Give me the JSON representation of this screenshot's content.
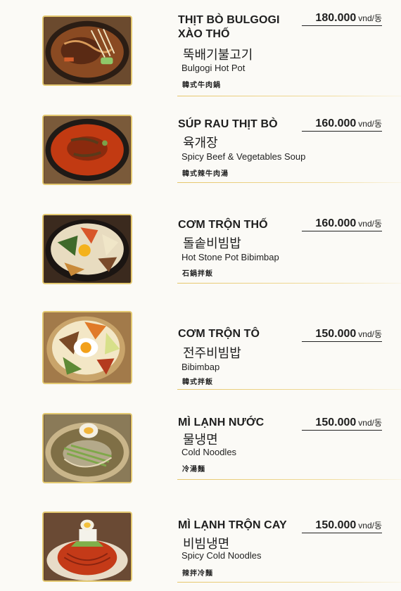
{
  "unit_label": "vnd/동",
  "items": [
    {
      "name": "THỊT BÒ BULGOGI XÀO THỐ",
      "price": "180.000",
      "korean": "뚝배기불고기",
      "english": "Bulgogi Hot Pot",
      "chinese": "韓式牛肉鍋"
    },
    {
      "name": "SÚP RAU THỊT BÒ",
      "price": "160.000",
      "korean": "육개장",
      "english": "Spicy Beef & Vegetables Soup",
      "chinese": "韓式辣牛肉湯"
    },
    {
      "name": "CƠM TRỘN THỐ",
      "price": "160.000",
      "korean": "돌솥비빔밥",
      "english": "Hot Stone Pot Bibimbap",
      "chinese": "石鍋拌飯"
    },
    {
      "name": "CƠM TRỘN TÔ",
      "price": "150.000",
      "korean": "전주비빔밥",
      "english": "Bibimbap",
      "chinese": "韓式拌飯"
    },
    {
      "name": "MÌ LẠNH NƯỚC",
      "price": "150.000",
      "korean": "물냉면",
      "english": "Cold Noodles",
      "chinese": "冷湯麵"
    },
    {
      "name": "MÌ LẠNH TRỘN CAY",
      "price": "150.000",
      "korean": "비빔냉면",
      "english": "Spicy Cold Noodles",
      "chinese": "辣拌冷麵"
    }
  ]
}
